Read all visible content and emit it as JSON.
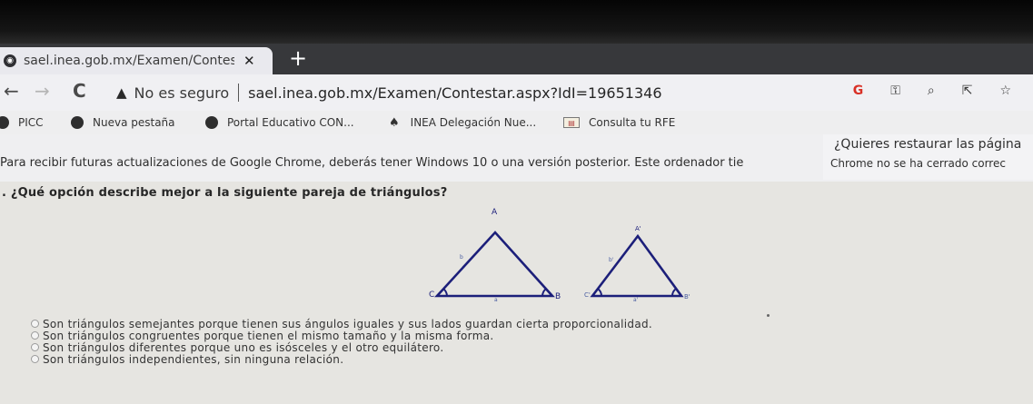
{
  "browser": {
    "tab": {
      "title": "sael.inea.gob.mx/Examen/Contesta",
      "close": "✕"
    },
    "new_tab": "+",
    "nav": {
      "back": "←",
      "forward": "→",
      "reload": "C"
    },
    "omnibox": {
      "security_warning": "No es seguro",
      "url": "sael.inea.gob.mx/Examen/Contestar.aspx?IdI=19651346"
    },
    "toolbar_icons": {
      "google": "G",
      "key": "⚿",
      "zoom": "⌕",
      "share": "⇱",
      "star": "☆"
    },
    "bookmarks": [
      {
        "label": "PICC"
      },
      {
        "label": "Nueva pestaña"
      },
      {
        "label": "Portal Educativo CON..."
      },
      {
        "label": "INEA Delegación Nue..."
      },
      {
        "label": "Consulta tu RFE"
      }
    ],
    "infobar_message": "Para recibir futuras actualizaciones de Google Chrome, deberás tener Windows 10 o una versión posterior. Este ordenador tie",
    "restore": {
      "title": "¿Quieres restaurar las página",
      "subtitle": "Chrome no se ha cerrado correc"
    }
  },
  "exam": {
    "question": ". ¿Qué opción describe mejor a la siguiente pareja de triángulos?",
    "figure": {
      "left": {
        "apex": "A",
        "left": "C",
        "right": "B",
        "side": "b",
        "base": "a"
      },
      "right": {
        "apex": "A'",
        "left": "C'",
        "right": "B'",
        "side": "b'",
        "base": "a'"
      }
    },
    "options": [
      {
        "label": "Son triángulos semejantes porque tienen sus ángulos iguales y sus lados guardan cierta proporcionalidad."
      },
      {
        "label": "Son triángulos congruentes porque tienen el mismo tamaño y la misma forma."
      },
      {
        "label": "Son triángulos diferentes porque uno es isósceles y el otro equilátero."
      },
      {
        "label": "Son triángulos independientes, sin ninguna relación."
      }
    ]
  }
}
